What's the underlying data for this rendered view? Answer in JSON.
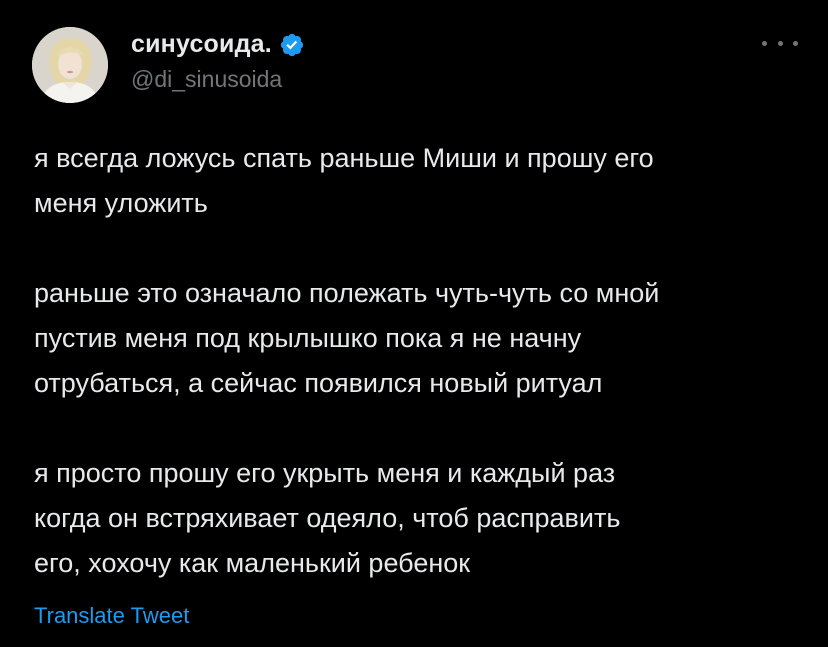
{
  "author": {
    "display_name": "синусоида.",
    "handle": "@di_sinusoida",
    "verified": true
  },
  "icons": {
    "verified": "verified-badge-icon",
    "more": "more-options-icon"
  },
  "tweet": {
    "paragraphs": [
      {
        "lines": [
          "я всегда ложусь спать раньше Миши и прошу его",
          "меня уложить"
        ]
      },
      {
        "lines": [
          "раньше это означало полежать чуть-чуть со мной",
          "пустив меня под крылышко пока я не начну",
          "отрубаться, а сейчас появился новый ритуал"
        ]
      },
      {
        "lines": [
          "я просто прошу его укрыть меня и каждый раз",
          "когда он встряхивает одеяло, чтоб расправить",
          "его, хохочу как маленький ребенок"
        ]
      }
    ],
    "translate_label": "Translate Tweet"
  },
  "colors": {
    "background": "#000000",
    "text_primary": "#e7e9ea",
    "text_secondary": "#71767b",
    "accent": "#1d9bf0"
  }
}
